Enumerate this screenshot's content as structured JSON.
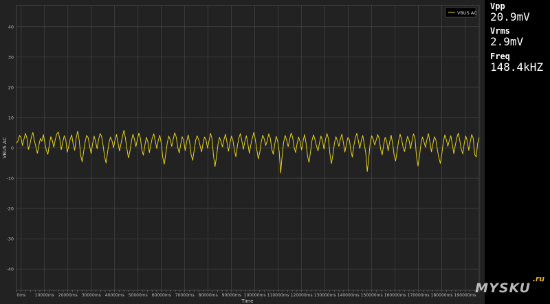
{
  "chart_data": {
    "type": "line",
    "xlabel": "Time",
    "ylabel": "VBUS AC",
    "xlim": [
      -2000,
      196000
    ],
    "ylim": [
      -47,
      47
    ],
    "x_ticks": [
      0,
      10000,
      20000,
      30000,
      40000,
      50000,
      60000,
      70000,
      80000,
      90000,
      100000,
      110000,
      120000,
      130000,
      140000,
      150000,
      160000,
      170000,
      180000,
      190000
    ],
    "x_tick_labels": [
      "0ms",
      "10000ms",
      "20000ms",
      "30000ms",
      "40000ms",
      "50000ms",
      "60000ms",
      "70000ms",
      "80000ms",
      "90000ms",
      "100000ms",
      "110000ms",
      "120000ms",
      "130000ms",
      "140000ms",
      "150000ms",
      "160000ms",
      "170000ms",
      "180000ms",
      "190000ms"
    ],
    "y_ticks": [
      40,
      30,
      20,
      10,
      0,
      -10,
      -20,
      -30,
      -40
    ],
    "y_tick_labels": [
      "40",
      "30",
      "20",
      "10",
      "0",
      "-10",
      "-20",
      "-30",
      "-40"
    ],
    "grid": true,
    "legend_position": "top-right",
    "series": [
      {
        "name": "VBUS AC",
        "color": "#e6d21e",
        "x_start": -2000,
        "x_end": 196000,
        "values": [
          1.5,
          2.3,
          4.1,
          3.5,
          0.8,
          2.9,
          4.8,
          3.2,
          -0.5,
          1.2,
          3.6,
          5.1,
          2.4,
          0.3,
          -1.8,
          0.9,
          3.1,
          2.2,
          4.4,
          1.6,
          -0.9,
          -2.1,
          1.0,
          3.7,
          2.5,
          0.2,
          2.8,
          4.6,
          5.2,
          3.0,
          -0.6,
          1.9,
          4.0,
          2.7,
          -1.4,
          0.5,
          2.9,
          4.3,
          1.1,
          -0.8,
          3.3,
          5.5,
          2.6,
          -2.5,
          -4.6,
          -1.2,
          2.0,
          4.1,
          3.4,
          0.6,
          -1.9,
          1.4,
          3.9,
          2.1,
          -0.3,
          2.7,
          4.7,
          3.8,
          0.9,
          -2.8,
          -5.0,
          -1.5,
          1.8,
          3.6,
          2.3,
          0.1,
          2.6,
          4.4,
          1.7,
          -1.0,
          1.3,
          3.8,
          5.8,
          3.1,
          -0.4,
          -3.3,
          -1.1,
          2.2,
          4.5,
          2.9,
          0.4,
          2.8,
          4.9,
          3.2,
          -0.7,
          -2.4,
          0.8,
          3.5,
          2.0,
          -1.6,
          1.0,
          3.4,
          4.6,
          2.2,
          -0.2,
          2.5,
          4.2,
          1.5,
          -3.1,
          -5.4,
          -2.0,
          1.6,
          3.9,
          2.7,
          0.5,
          2.9,
          5.0,
          3.6,
          0.3,
          -1.7,
          1.1,
          3.7,
          2.4,
          -0.9,
          2.0,
          4.3,
          1.8,
          -2.2,
          -4.1,
          -1.0,
          2.4,
          4.0,
          2.8,
          0.7,
          -1.3,
          1.5,
          3.6,
          2.6,
          -0.1,
          2.3,
          4.8,
          3.0,
          -2.6,
          -6.2,
          -3.0,
          1.2,
          3.5,
          2.1,
          0.3,
          2.7,
          4.5,
          1.9,
          -1.1,
          1.6,
          3.9,
          2.5,
          -0.8,
          -2.9,
          0.6,
          3.3,
          4.7,
          2.3,
          -0.5,
          2.1,
          4.0,
          1.4,
          -1.8,
          1.0,
          3.2,
          5.1,
          2.8,
          -0.6,
          -3.6,
          -1.4,
          2.0,
          4.2,
          2.9,
          0.8,
          2.4,
          4.6,
          3.3,
          -0.3,
          -2.1,
          1.2,
          3.8,
          2.2,
          -1.2,
          -8.3,
          -2.5,
          1.9,
          4.1,
          2.6,
          0.4,
          2.8,
          4.9,
          3.5,
          0.2,
          -1.5,
          1.4,
          3.6,
          2.0,
          -0.7,
          2.2,
          4.4,
          1.6,
          -2.7,
          -4.8,
          -1.3,
          2.5,
          4.3,
          2.7,
          0.6,
          -1.0,
          1.7,
          3.9,
          2.4,
          -0.4,
          2.6,
          4.7,
          3.1,
          -2.0,
          -5.2,
          -2.2,
          1.5,
          3.7,
          2.3,
          0.5,
          2.9,
          4.5,
          1.8,
          -1.4,
          1.1,
          3.4,
          2.7,
          -0.9,
          -3.0,
          0.7,
          3.2,
          4.8,
          2.5,
          -0.2,
          2.3,
          4.1,
          1.3,
          -1.7,
          -7.8,
          -3.5,
          1.8,
          4.0,
          2.8,
          0.9,
          2.6,
          4.4,
          3.0,
          -0.5,
          -2.3,
          1.0,
          3.5,
          2.2,
          -1.0,
          1.9,
          4.2,
          1.5,
          -2.4,
          -4.3,
          -1.1,
          2.3,
          4.5,
          2.9,
          0.3,
          -1.2,
          1.6,
          3.8,
          2.5,
          -0.3,
          2.4,
          4.6,
          3.2,
          -2.8,
          -6.0,
          -2.7,
          1.4,
          3.6,
          2.0,
          0.2,
          2.8,
          4.7,
          1.9,
          -1.3,
          1.3,
          3.7,
          2.6,
          -0.6,
          -3.4,
          -5.1,
          -1.8,
          2.1,
          4.3,
          2.7,
          0.5,
          2.5,
          4.0,
          1.2,
          -1.9,
          0.9,
          3.3,
          4.9,
          2.4,
          -0.4,
          -2.0,
          1.5,
          3.9,
          2.3,
          -0.8,
          2.0,
          4.4,
          3.1,
          -2.2,
          -3.0,
          1.6,
          3.4
        ]
      }
    ]
  },
  "readouts": [
    {
      "label": "Vpp",
      "value": "20.9mV"
    },
    {
      "label": "Vrms",
      "value": "2.9mV"
    },
    {
      "label": "Freq",
      "value": "148.4kHZ"
    }
  ],
  "watermark": {
    "text": "MYSKU",
    "suffix": ".ru"
  },
  "colors": {
    "background": "#222222",
    "grid": "#4a4a4a",
    "side_panel": "#000000",
    "trace": "#e6d21e"
  }
}
